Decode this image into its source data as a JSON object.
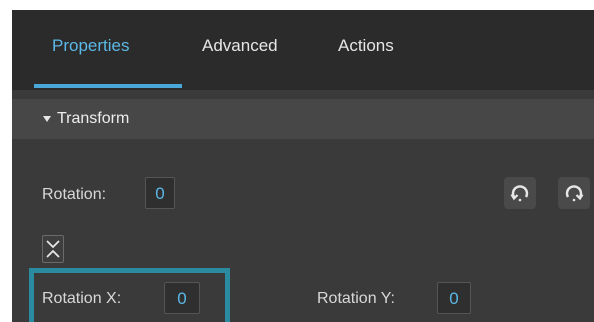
{
  "tabs": [
    {
      "label": "Properties",
      "active": true
    },
    {
      "label": "Advanced",
      "active": false
    },
    {
      "label": "Actions",
      "active": false
    }
  ],
  "section": {
    "title": "Transform",
    "expanded": true
  },
  "rotation": {
    "label": "Rotation:",
    "value": "0"
  },
  "rotation_x": {
    "label": "Rotation X:",
    "value": "0"
  },
  "rotation_y": {
    "label": "Rotation Y:",
    "value": "0"
  },
  "icons": {
    "rotate_ccw": "rotate-counterclockwise-icon",
    "rotate_cw": "rotate-clockwise-icon",
    "link": "unlink-chevrons-icon"
  },
  "colors": {
    "accent": "#5bb8e6",
    "highlight": "#2a8aa0",
    "panel": "#3a3a3a"
  }
}
